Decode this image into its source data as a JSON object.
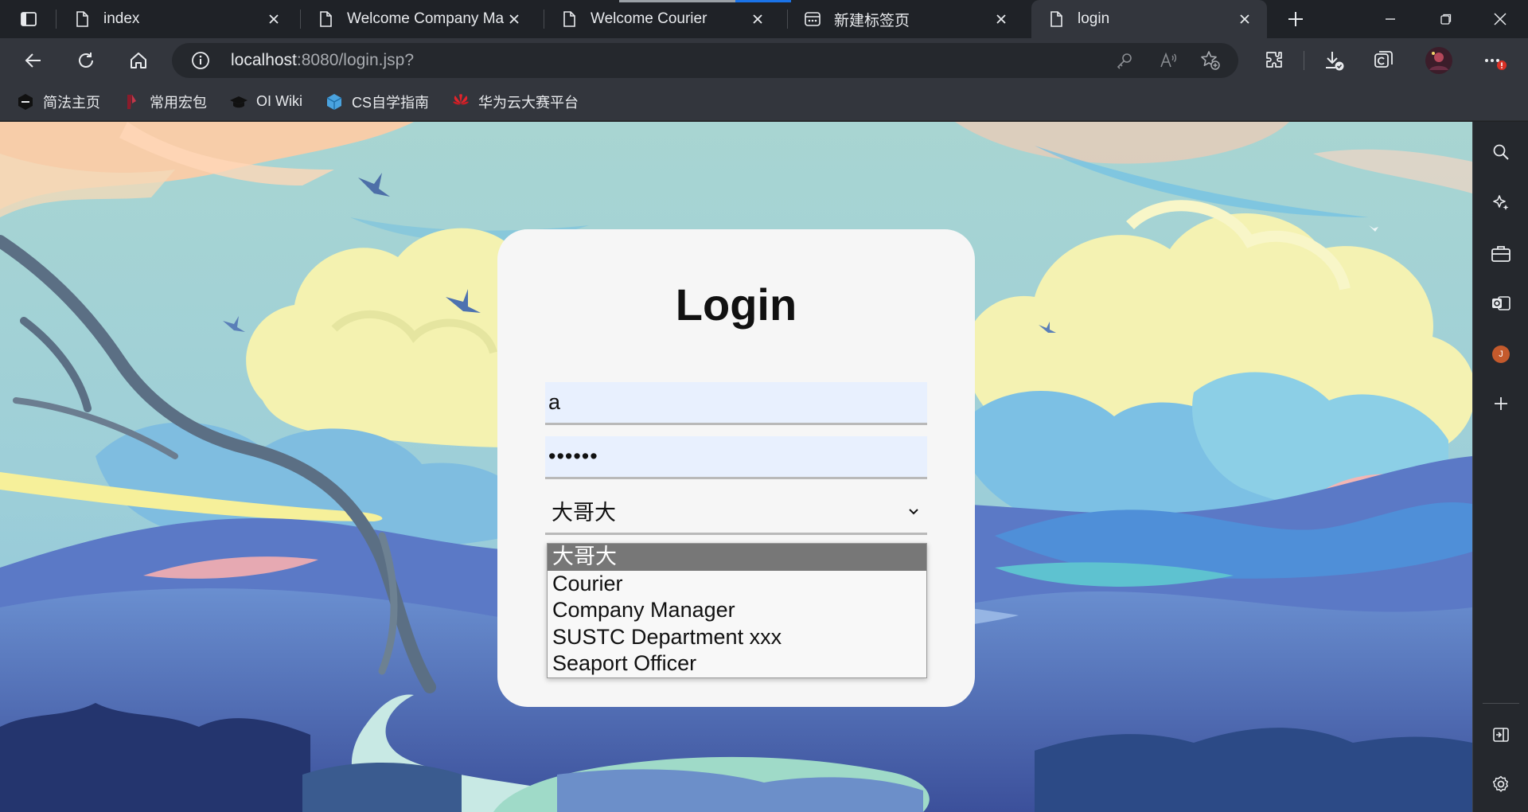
{
  "tabs": [
    {
      "title": "index",
      "icon": "page-icon",
      "active": false
    },
    {
      "title": "Welcome Company Manag",
      "icon": "page-icon",
      "active": false
    },
    {
      "title": "Welcome Courier",
      "icon": "page-icon",
      "active": false
    },
    {
      "title": "新建标签页",
      "icon": "newtab-icon",
      "active": false
    },
    {
      "title": "login",
      "icon": "page-icon",
      "active": true
    }
  ],
  "address": {
    "host": "localhost",
    "path": ":8080/login.jsp?"
  },
  "bookmarks": [
    {
      "label": "简法主页",
      "icon": "hexagon-icon"
    },
    {
      "label": "常用宏包",
      "icon": "bookmark-red-icon"
    },
    {
      "label": "OI Wiki",
      "icon": "graduation-cap-icon"
    },
    {
      "label": "CS自学指南",
      "icon": "cube-icon"
    },
    {
      "label": "华为云大赛平台",
      "icon": "huawei-icon"
    }
  ],
  "login": {
    "title": "Login",
    "username": "a",
    "password": "••••••",
    "selected_role": "大哥大",
    "roles": [
      "大哥大",
      "Courier",
      "Company Manager",
      "SUSTC Department xxx",
      "Seaport Officer"
    ]
  },
  "sidebar": {
    "profile_letter": "J"
  },
  "colors": {
    "accent": "#1a73e8",
    "card": "#f6f6f6",
    "input": "#e8f0fe",
    "selected_option": "#777777"
  }
}
